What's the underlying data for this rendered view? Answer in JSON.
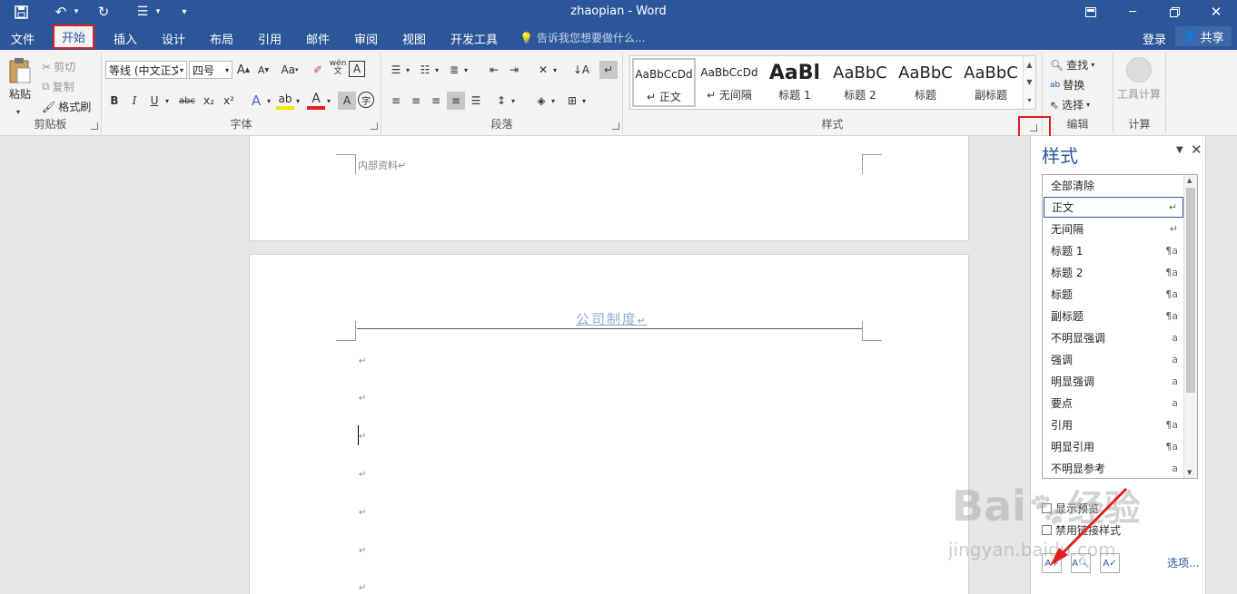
{
  "titlebar": {
    "title": "zhaopian - Word",
    "qa_icons": [
      "save-icon",
      "undo-icon",
      "redo-icon",
      "list-icon",
      "customize-icon"
    ]
  },
  "menu": {
    "tabs": [
      "文件",
      "开始",
      "插入",
      "设计",
      "布局",
      "引用",
      "邮件",
      "审阅",
      "视图",
      "开发工具"
    ],
    "active_tab": "开始",
    "tell_me": "告诉我您想要做什么...",
    "login": "登录",
    "share": "共享"
  },
  "ribbon": {
    "clipboard": {
      "label": "剪贴板",
      "paste": "粘贴",
      "cut": "剪切",
      "copy": "复制",
      "format_painter": "格式刷"
    },
    "font": {
      "label": "字体",
      "font_name": "等线 (中文正文)",
      "font_size": "四号",
      "change_case": "Aa",
      "phonetic": "wén",
      "bold": "B",
      "italic": "I",
      "underline": "U",
      "strikethrough": "abc",
      "subscript": "x₂",
      "superscript": "x²"
    },
    "paragraph": {
      "label": "段落"
    },
    "styles": {
      "label": "样式",
      "items": [
        {
          "sample": "AaBbCcDd",
          "name": "正文"
        },
        {
          "sample": "AaBbCcDd",
          "name": "无间隔"
        },
        {
          "sample": "AaBl",
          "name": "标题 1"
        },
        {
          "sample": "AaBbC",
          "name": "标题 2"
        },
        {
          "sample": "AaBbC",
          "name": "标题"
        },
        {
          "sample": "AaBbC",
          "name": "副标题"
        }
      ]
    },
    "editing": {
      "label": "编辑",
      "find": "查找",
      "replace": "替换",
      "select": "选择"
    },
    "compute": {
      "label": "计算",
      "tool": "工具计算"
    }
  },
  "document": {
    "header_text": "内部资料",
    "page2_header": "公司制度",
    "para_mark": "↵"
  },
  "styles_pane": {
    "title": "样式",
    "items": [
      {
        "name": "全部清除",
        "mark": ""
      },
      {
        "name": "正文",
        "mark": "↵"
      },
      {
        "name": "无间隔",
        "mark": "↵"
      },
      {
        "name": "标题 1",
        "mark": "¶a"
      },
      {
        "name": "标题 2",
        "mark": "¶a"
      },
      {
        "name": "标题",
        "mark": "¶a"
      },
      {
        "name": "副标题",
        "mark": "¶a"
      },
      {
        "name": "不明显强调",
        "mark": "a"
      },
      {
        "name": "强调",
        "mark": "a"
      },
      {
        "name": "明显强调",
        "mark": "a"
      },
      {
        "name": "要点",
        "mark": "a"
      },
      {
        "name": "引用",
        "mark": "¶a"
      },
      {
        "name": "明显引用",
        "mark": "¶a"
      },
      {
        "name": "不明显参考",
        "mark": "a"
      }
    ],
    "selected": "正文",
    "show_preview": "显示预览",
    "disable_linked": "禁用链接样式",
    "options": "选项..."
  },
  "watermark": {
    "brand": "Bai",
    "brand2": "经验",
    "url": "jingyan.baidu.com"
  },
  "colors": {
    "accent": "#2b579a",
    "highlight": "#e02020"
  }
}
